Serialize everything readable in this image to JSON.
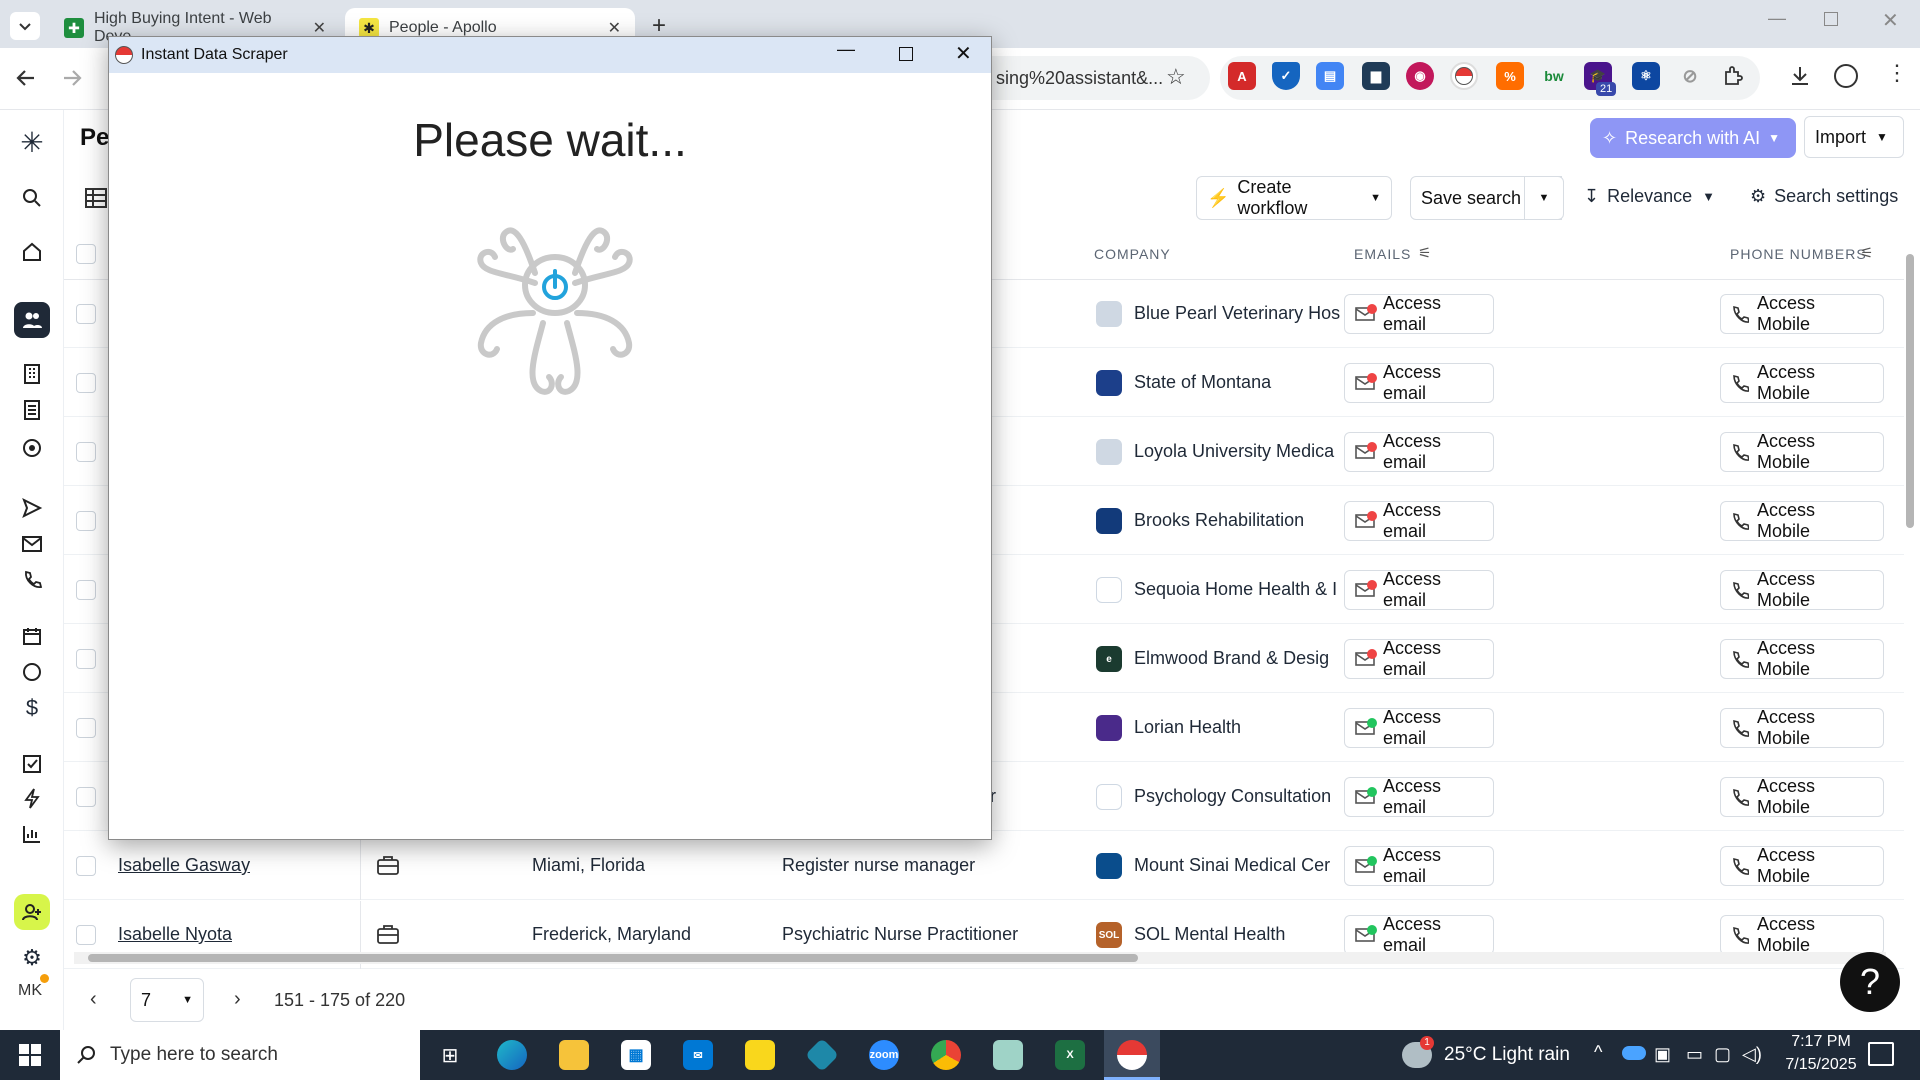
{
  "browser": {
    "tabs": [
      {
        "title": "High Buying Intent - Web Deve",
        "favicon_color": "#1e8e3e"
      },
      {
        "title": "People - Apollo",
        "favicon_color": "#f5e642"
      }
    ],
    "address_fragment": "sing%20assistant&...",
    "extension_badge": "21"
  },
  "apollo": {
    "page_title_partial": "Pe",
    "header": {
      "research_ai_label": "Research with AI",
      "import_label": "Import",
      "create_workflow_label": "Create workflow",
      "save_search_label": "Save search",
      "relevance_label": "Relevance",
      "search_settings_label": "Search settings"
    },
    "columns": {
      "company": "COMPANY",
      "emails": "EMAILS",
      "phone_numbers": "PHONE NUMBERS"
    },
    "rows": [
      {
        "company": "Blue Pearl Veterinary Hos",
        "email_status": "bad",
        "logo_color": "#cfd8e3",
        "logo_text": ""
      },
      {
        "company": "State of Montana",
        "email_status": "bad",
        "logo_color": "#1c3f8a",
        "logo_text": ""
      },
      {
        "company": "Loyola University Medica",
        "email_status": "bad",
        "logo_color": "#cfd8e3",
        "logo_text": ""
      },
      {
        "company": "Brooks Rehabilitation",
        "email_status": "bad",
        "logo_color": "#123a7a",
        "logo_text": ""
      },
      {
        "company": "Sequoia Home Health & I",
        "email_status": "bad",
        "logo_color": "#ffffff",
        "logo_text": ""
      },
      {
        "company": "Elmwood Brand & Desig",
        "email_status": "bad",
        "logo_color": "#1b3b30",
        "logo_text": "e"
      },
      {
        "company": "Lorian Health",
        "email_status": "good",
        "logo_color": "#4a2a8a",
        "logo_text": ""
      },
      {
        "company": "Psychology Consultation",
        "email_status": "good",
        "logo_color": "#ffffff",
        "logo_text": ""
      },
      {
        "name": "Isabelle Gasway",
        "location": "Miami, Florida",
        "title": "Register nurse manager",
        "company": "Mount Sinai Medical Cer",
        "email_status": "good",
        "logo_color": "#0a4d8c",
        "logo_text": ""
      },
      {
        "name": "Isabelle Nyota",
        "location": "Frederick, Maryland",
        "title": "Psychiatric Nurse Practitioner",
        "company": "SOL Mental Health",
        "email_status": "good",
        "logo_color": "#b5622a",
        "logo_text": "SOL"
      }
    ],
    "title_fragment": "r",
    "access_email_label": "Access email",
    "access_mobile_label": "Access Mobile",
    "pagination": {
      "page": "7",
      "range": "151 - 175 of 220"
    },
    "help_label": "?",
    "avatar_initials": "MK"
  },
  "scraper": {
    "window_title": "Instant Data Scraper",
    "message": "Please wait..."
  },
  "taskbar": {
    "search_placeholder": "Type here to search",
    "weather": "25°C  Light rain",
    "weather_badge": "1",
    "time": "7:17 PM",
    "date": "7/15/2025"
  }
}
